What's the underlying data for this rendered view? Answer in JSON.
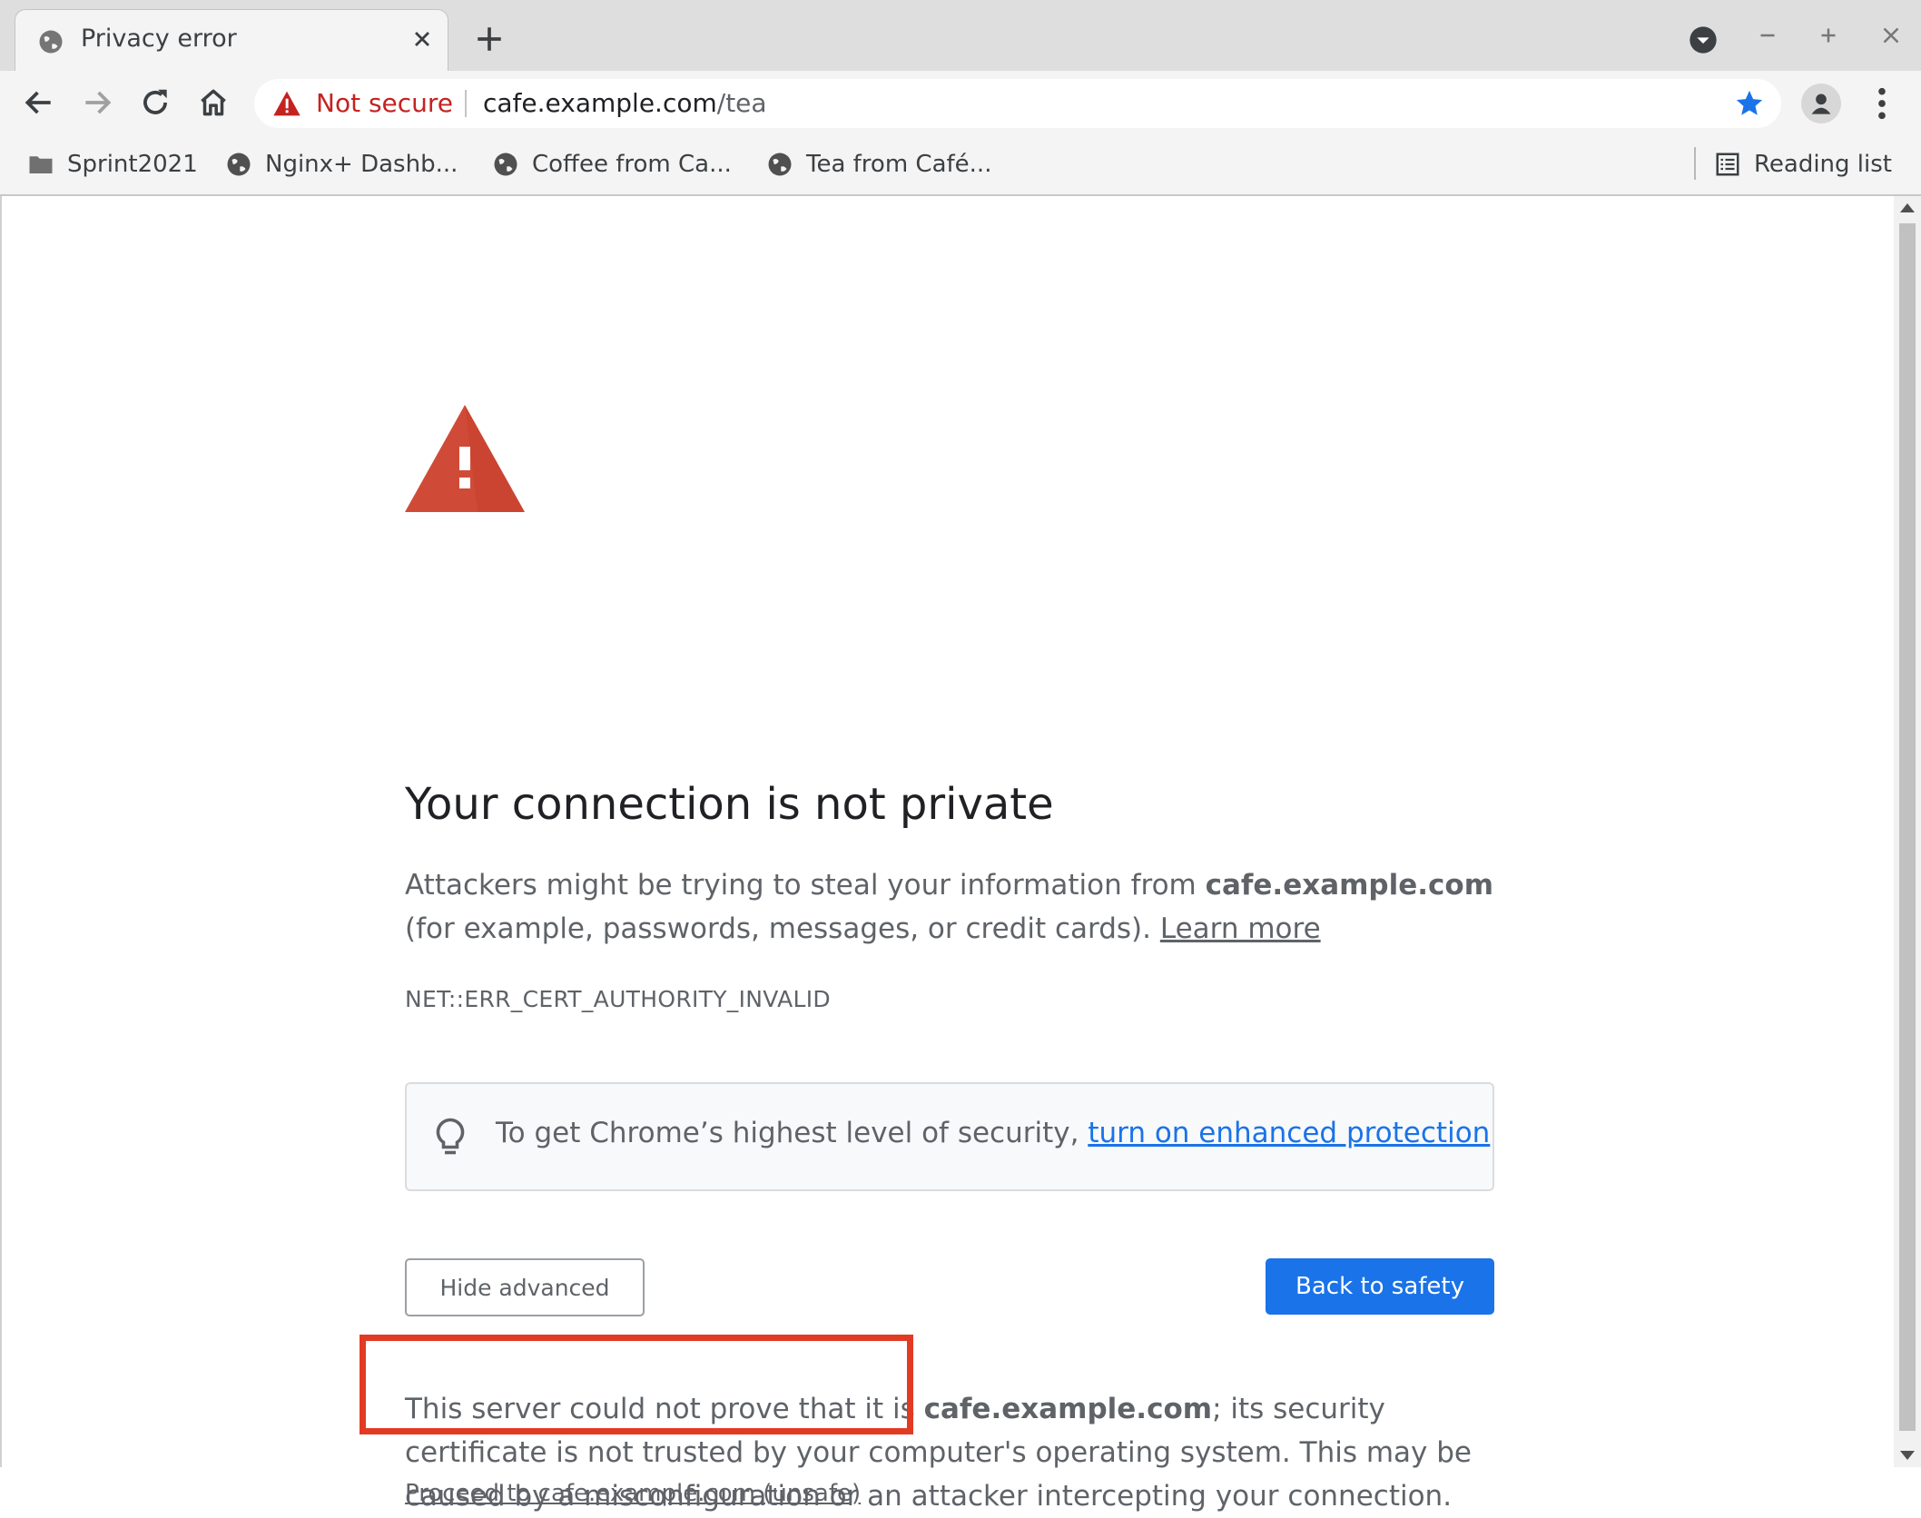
{
  "browser": {
    "tab": {
      "title": "Privacy error"
    },
    "omnibox": {
      "security_label": "Not secure",
      "host": "cafe.example.com",
      "path": "/tea"
    },
    "bookmarks": [
      {
        "label": "Sprint2021",
        "icon": "folder-icon"
      },
      {
        "label": "Nginx+ Dashb...",
        "icon": "globe-icon"
      },
      {
        "label": "Coffee from Ca...",
        "icon": "globe-icon"
      },
      {
        "label": "Tea from Café...",
        "icon": "globe-icon"
      }
    ],
    "reading_list": "Reading list"
  },
  "page": {
    "headline": "Your connection is not private",
    "description": {
      "pre": "Attackers might be trying to steal your information from ",
      "host": "cafe.example.com",
      "post": " (for example, passwords, messages, or credit cards). ",
      "learn_more": "Learn more"
    },
    "error_code": "NET::ERR_CERT_AUTHORITY_INVALID",
    "enhanced": {
      "text": "To get Chrome’s highest level of security, ",
      "link": "turn on enhanced protection"
    },
    "buttons": {
      "hide_advanced": "Hide advanced",
      "back_to_safety": "Back to safety"
    },
    "details": {
      "pre": "This server could not prove that it is ",
      "host": "cafe.example.com",
      "post": "; its security certificate is not trusted by your computer's operating system. This may be caused by a misconfiguration or an attacker intercepting your connection."
    },
    "proceed_link": "Proceed to cafe.example.com (unsafe)"
  },
  "colors": {
    "warning_red": "#d04b37",
    "not_secure_red": "#c5221f",
    "primary_blue": "#1a73e8",
    "annotation_red": "#e23b24"
  }
}
